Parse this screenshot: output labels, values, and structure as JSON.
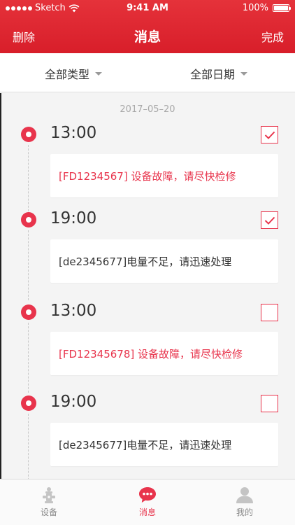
{
  "status_bar": {
    "carrier": "Sketch",
    "time": "9:41 AM",
    "battery": "100%",
    "battery_level": 1.0
  },
  "nav": {
    "left_label": "删除",
    "title": "消息",
    "right_label": "完成"
  },
  "filters": {
    "type_label": "全部类型",
    "date_label": "全部日期"
  },
  "date_header": "2017–05–20",
  "messages": [
    {
      "time": "13:00",
      "text": "[FD1234567]  设备故障，请尽快检修",
      "checked": true,
      "alert": true
    },
    {
      "time": "19:00",
      "text": "[de2345677]电量不足，请迅速处理",
      "checked": true,
      "alert": false
    },
    {
      "time": "13:00",
      "text": "[FD12345678]  设备故障，请尽快检修",
      "checked": false,
      "alert": true
    },
    {
      "time": "19:00",
      "text": "[de2345677]电量不足，请迅速处理",
      "checked": false,
      "alert": false
    }
  ],
  "tabs": [
    {
      "label": "设备",
      "icon": "hydrant-icon",
      "active": false
    },
    {
      "label": "消息",
      "icon": "chat-bubble-icon",
      "active": true
    },
    {
      "label": "我的",
      "icon": "user-icon",
      "active": false
    }
  ],
  "colors": {
    "brand_red": "#e5323a",
    "accent_red": "#e8344c",
    "inactive_gray": "#8a8a8a"
  }
}
